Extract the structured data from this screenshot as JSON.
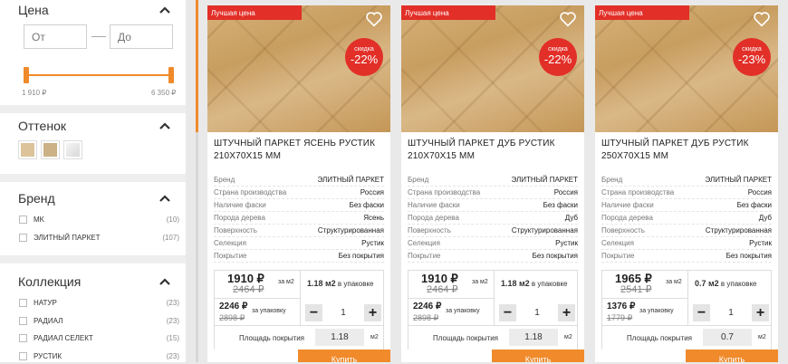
{
  "filters": {
    "price": {
      "title": "Цена",
      "from_placeholder": "От",
      "to_placeholder": "До",
      "min_label": "1 910 ₽",
      "max_label": "6 350 ₽"
    },
    "shade": {
      "title": "Оттенок",
      "swatches": [
        "#dcc39a",
        "#cbb185",
        "#e7e7e7"
      ]
    },
    "brand": {
      "title": "Бренд",
      "items": [
        {
          "name": "MK",
          "count": "(10)"
        },
        {
          "name": "ЭЛИТНЫЙ ПАРКЕТ",
          "count": "(107)"
        }
      ]
    },
    "collection": {
      "title": "Коллекция",
      "items": [
        {
          "name": "НАТУР",
          "count": "(23)"
        },
        {
          "name": "РАДИАЛ",
          "count": "(23)"
        },
        {
          "name": "РАДИАЛ СЕЛЕКТ",
          "count": "(15)"
        },
        {
          "name": "РУСТИК",
          "count": "(23)"
        }
      ]
    }
  },
  "colors": {
    "accent": "#f08a2b",
    "badge_red": "#e22f28"
  },
  "products": [
    {
      "badge": "Лучшая цена",
      "discount_label": "скидка",
      "discount": "-22%",
      "title_line1": "ШТУЧНЫЙ ПАРКЕТ ЯСЕНЬ РУСТИК",
      "title_line2": "210Х70Х15 ММ",
      "specs": [
        {
          "k": "Бренд",
          "v": "ЭЛИТНЫЙ ПАРКЕТ"
        },
        {
          "k": "Страна производства",
          "v": "Россия"
        },
        {
          "k": "Наличие фаски",
          "v": "Без фаски"
        },
        {
          "k": "Порода дерева",
          "v": "Ясень"
        },
        {
          "k": "Поверхность",
          "v": "Структурированная"
        },
        {
          "k": "Селекция",
          "v": "Рустик"
        },
        {
          "k": "Покрытие",
          "v": "Без покрытия"
        }
      ],
      "price_m2": "1910 ₽",
      "old_m2": "2464 ₽",
      "per_m2": "за м2",
      "pack_qty": "1.18 м2",
      "pack_text": "в упаковке",
      "price_pack": "2246 ₽",
      "old_pack": "2898 ₽",
      "per_pack": "за упаковку",
      "qty": "1",
      "area_label": "Площадь покрытия",
      "area": "1.18",
      "area_unit": "м2",
      "buy": "Купить"
    },
    {
      "badge": "Лучшая цена",
      "discount_label": "скидка",
      "discount": "-22%",
      "title_line1": "ШТУЧНЫЙ ПАРКЕТ ДУБ РУСТИК",
      "title_line2": "210Х70Х15 ММ",
      "specs": [
        {
          "k": "Бренд",
          "v": "ЭЛИТНЫЙ ПАРКЕТ"
        },
        {
          "k": "Страна производства",
          "v": "Россия"
        },
        {
          "k": "Наличие фаски",
          "v": "Без фаски"
        },
        {
          "k": "Порода дерева",
          "v": "Дуб"
        },
        {
          "k": "Поверхность",
          "v": "Структурированная"
        },
        {
          "k": "Селекция",
          "v": "Рустик"
        },
        {
          "k": "Покрытие",
          "v": "Без покрытия"
        }
      ],
      "price_m2": "1910 ₽",
      "old_m2": "2464 ₽",
      "per_m2": "за м2",
      "pack_qty": "1.18 м2",
      "pack_text": "в упаковке",
      "price_pack": "2246 ₽",
      "old_pack": "2898 ₽",
      "per_pack": "за упаковку",
      "qty": "1",
      "area_label": "Площадь покрытия",
      "area": "1.18",
      "area_unit": "м2",
      "buy": "Купить"
    },
    {
      "badge": "Лучшая цена",
      "discount_label": "скидка",
      "discount": "-23%",
      "title_line1": "ШТУЧНЫЙ ПАРКЕТ ДУБ РУСТИК",
      "title_line2": "250Х70Х15 ММ",
      "specs": [
        {
          "k": "Бренд",
          "v": "ЭЛИТНЫЙ ПАРКЕТ"
        },
        {
          "k": "Страна производства",
          "v": "Россия"
        },
        {
          "k": "Наличие фаски",
          "v": "Без фаски"
        },
        {
          "k": "Порода дерева",
          "v": "Дуб"
        },
        {
          "k": "Поверхность",
          "v": "Структурированная"
        },
        {
          "k": "Селекция",
          "v": "Рустик"
        },
        {
          "k": "Покрытие",
          "v": "Без покрытия"
        }
      ],
      "price_m2": "1965 ₽",
      "old_m2": "2541 ₽",
      "per_m2": "за м2",
      "pack_qty": "0.7 м2",
      "pack_text": "в упаковке",
      "price_pack": "1376 ₽",
      "old_pack": "1779 ₽",
      "per_pack": "за упаковку",
      "qty": "1",
      "area_label": "Площадь покрытия",
      "area": "0.7",
      "area_unit": "м2",
      "buy": "Купить"
    }
  ]
}
